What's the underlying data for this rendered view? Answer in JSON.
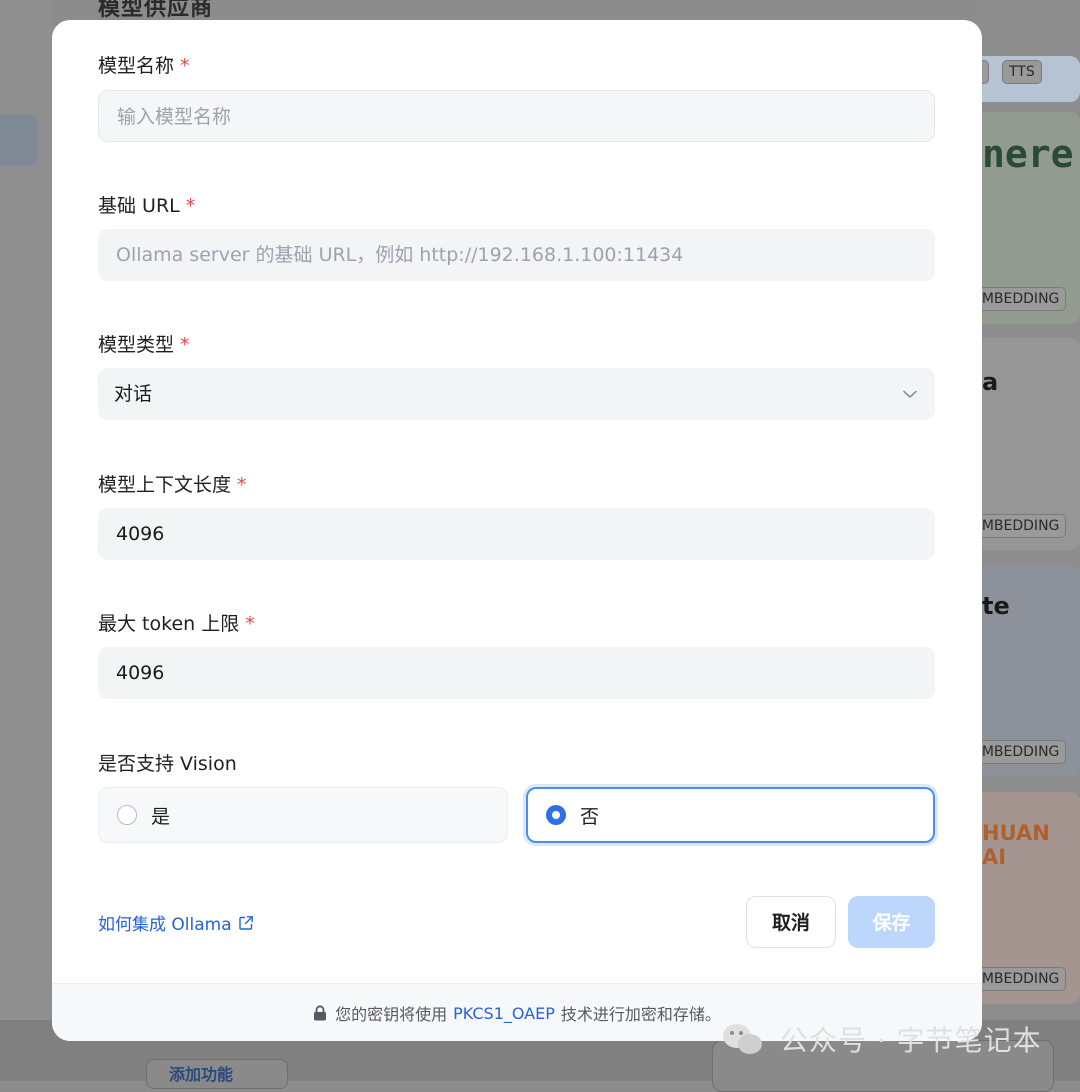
{
  "background": {
    "section_title": "模型供应商",
    "tags": {
      "tag_t": "T",
      "tag_tts": "TTS",
      "embedding": "EMBEDDING"
    },
    "brands": {
      "cohere": "nere",
      "b2": "a",
      "b3": "te",
      "b4": "HUAN AI"
    },
    "add_button": "添加功能",
    "watermark": "公众号 · 字节笔记本"
  },
  "form": {
    "model_name": {
      "label": "模型名称",
      "placeholder": "输入模型名称",
      "value": ""
    },
    "base_url": {
      "label": "基础 URL",
      "placeholder": "Ollama server 的基础 URL，例如 http://192.168.1.100:11434",
      "value": ""
    },
    "model_type": {
      "label": "模型类型",
      "value": "对话"
    },
    "context_length": {
      "label": "模型上下文长度",
      "value": "4096"
    },
    "max_tokens": {
      "label": "最大 token 上限",
      "value": "4096"
    },
    "vision": {
      "label": "是否支持 Vision",
      "yes": "是",
      "no": "否",
      "selected": "否"
    },
    "required_mark": "*"
  },
  "actions": {
    "help_link": "如何集成 Ollama",
    "cancel": "取消",
    "save": "保存"
  },
  "footer": {
    "prefix": "您的密钥将使用",
    "highlight": "PKCS1_OAEP",
    "suffix": "技术进行加密和存储。"
  },
  "colors": {
    "accent": "#2f6fe4",
    "required": "#e5484d",
    "save_disabled": "#bcd7fb"
  }
}
